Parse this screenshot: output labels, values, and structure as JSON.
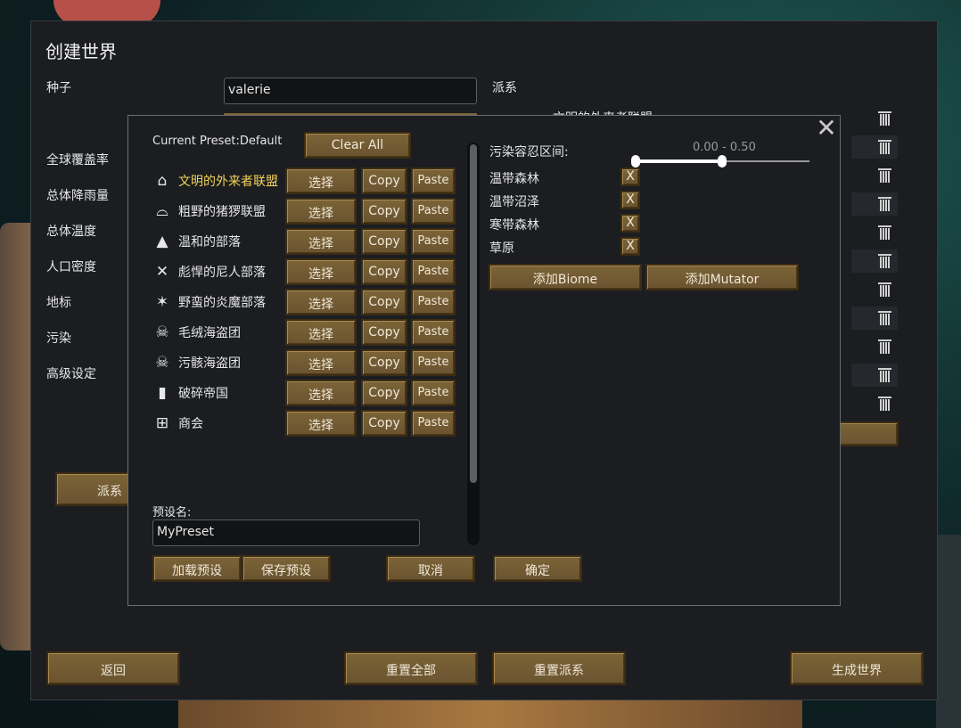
{
  "window": {
    "title": "创建世界"
  },
  "left_labels": [
    "种子",
    "全球覆盖率",
    "总体降雨量",
    "总体温度",
    "人口密度",
    "地标",
    "污染",
    "高级设定"
  ],
  "seed": {
    "value": "valerie"
  },
  "factions_header": "派系",
  "factions_first_item": "文明的外来者联盟",
  "bottom_buttons": {
    "back": "返回",
    "reset_all": "重置全部",
    "reset_factions": "重置派系",
    "generate": "生成世界"
  },
  "partial_faction_button": "派系",
  "dialog": {
    "current_preset": "Current Preset:Default",
    "clear_all": "Clear All",
    "select_label": "选择",
    "copy_label": "Copy",
    "paste_label": "Paste",
    "factions": [
      {
        "name": "文明的外来者联盟",
        "icon": "house-icon",
        "highlight": true
      },
      {
        "name": "粗野的猪猡联盟",
        "icon": "barn-icon",
        "highlight": false
      },
      {
        "name": "温和的部落",
        "icon": "tent-icon",
        "highlight": false
      },
      {
        "name": "彪悍的尼人部落",
        "icon": "crossed-tusks-icon",
        "highlight": false
      },
      {
        "name": "野蛮的炎魔部落",
        "icon": "flame-horns-icon",
        "highlight": false
      },
      {
        "name": "毛绒海盗团",
        "icon": "skull-icon",
        "highlight": false
      },
      {
        "name": "污骸海盗团",
        "icon": "skull-crossbones-icon",
        "highlight": false
      },
      {
        "name": "破碎帝国",
        "icon": "pillar-icon",
        "highlight": false
      },
      {
        "name": "商会",
        "icon": "trade-icon",
        "highlight": false
      }
    ],
    "pollution_label": "污染容忍区间:",
    "pollution_range_text": "0.00 - 0.50",
    "pollution_range": [
      0.0,
      0.5
    ],
    "biomes": [
      "温带森林",
      "温带沼泽",
      "寒带森林",
      "草原"
    ],
    "remove_label": "X",
    "add_biome": "添加Biome",
    "add_mutator": "添加Mutator",
    "preset_name_label": "预设名:",
    "preset_name_value": "MyPreset",
    "load_preset": "加载预设",
    "save_preset": "保存预设",
    "cancel": "取消",
    "confirm": "确定"
  },
  "colors": {
    "button_bg": "#7c6437",
    "highlight_text": "#f2d35a",
    "panel_bg": "#1b1d20"
  }
}
